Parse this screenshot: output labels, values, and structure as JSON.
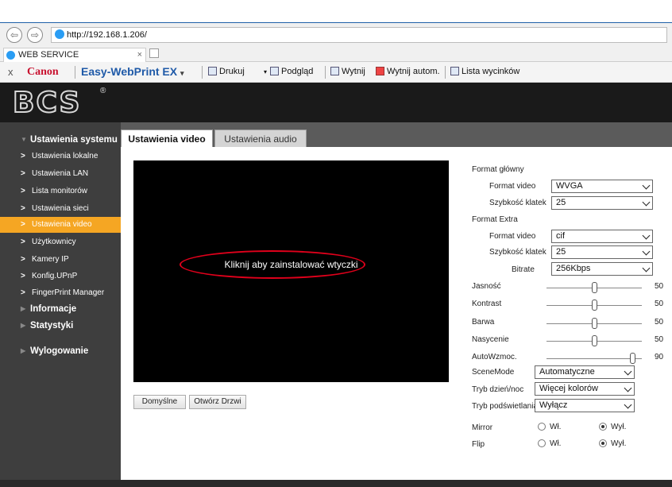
{
  "browser": {
    "address": "http://192.168.1.206/",
    "tab_title": "WEB SERVICE",
    "tab_close": "×",
    "nav_back": "⇦",
    "nav_forward": "⇨"
  },
  "toolbar": {
    "close": "x",
    "canon": "Canon",
    "easy_webprint": "Easy-WebPrint EX",
    "dropdown_arrow": "▾",
    "print": "Drukuj",
    "preview": "Podgląd",
    "cut": "Wytnij",
    "auto_cut": "Wytnij autom.",
    "clip_list": "Lista wycinków"
  },
  "app": {
    "logo": "BCS",
    "logo_mark": "®"
  },
  "sidebar": {
    "system_settings": "Ustawienia systemu",
    "items": [
      "Ustawienia lokalne",
      "Ustawienia LAN",
      "Lista monitorów",
      "Ustawienia sieci",
      "Ustawienia video",
      "Użytkownicy",
      "Kamery IP",
      "Konfig.UPnP",
      "FingerPrint Manager"
    ],
    "info": "Informacje",
    "stats": "Statystyki",
    "logout": "Wylogowanie"
  },
  "tabs": {
    "video": "Ustawienia video",
    "audio": "Ustawienia audio"
  },
  "player": {
    "install_plugin": "Kliknij aby zainstalować wtyczki"
  },
  "buttons": {
    "default": "Domyślne",
    "open_door": "Otwórz Drzwi"
  },
  "settings": {
    "main_format": "Format główny",
    "video_format_label": "Format video",
    "video_format_value": "WVGA",
    "frame_rate_label": "Szybkość klatek",
    "frame_rate_value": "25",
    "extra_format": "Format Extra",
    "extra_video_format_label": "Format video",
    "extra_video_format_value": "cif",
    "extra_frame_rate_label": "Szybkość klatek",
    "extra_frame_rate_value": "25",
    "bitrate_label": "Bitrate",
    "bitrate_value": "256Kbps",
    "sliders": [
      {
        "label": "Jasność",
        "value": 50
      },
      {
        "label": "Kontrast",
        "value": 50
      },
      {
        "label": "Barwa",
        "value": 50
      },
      {
        "label": "Nasycenie",
        "value": 50
      },
      {
        "label": "AutoWzmoc.",
        "value": 90
      }
    ],
    "scene_mode_label": "SceneMode",
    "scene_mode_value": "Automatyczne",
    "day_night_label": "Tryb dzień/noc",
    "day_night_value": "Więcej kolorów",
    "backlight_label": "Tryb podświetlania",
    "backlight_value": "Wyłącz",
    "mirror_label": "Mirror",
    "flip_label": "Flip",
    "on_label": "Wł.",
    "off_label": "Wył.",
    "mirror_state": "off",
    "flip_state": "off"
  }
}
